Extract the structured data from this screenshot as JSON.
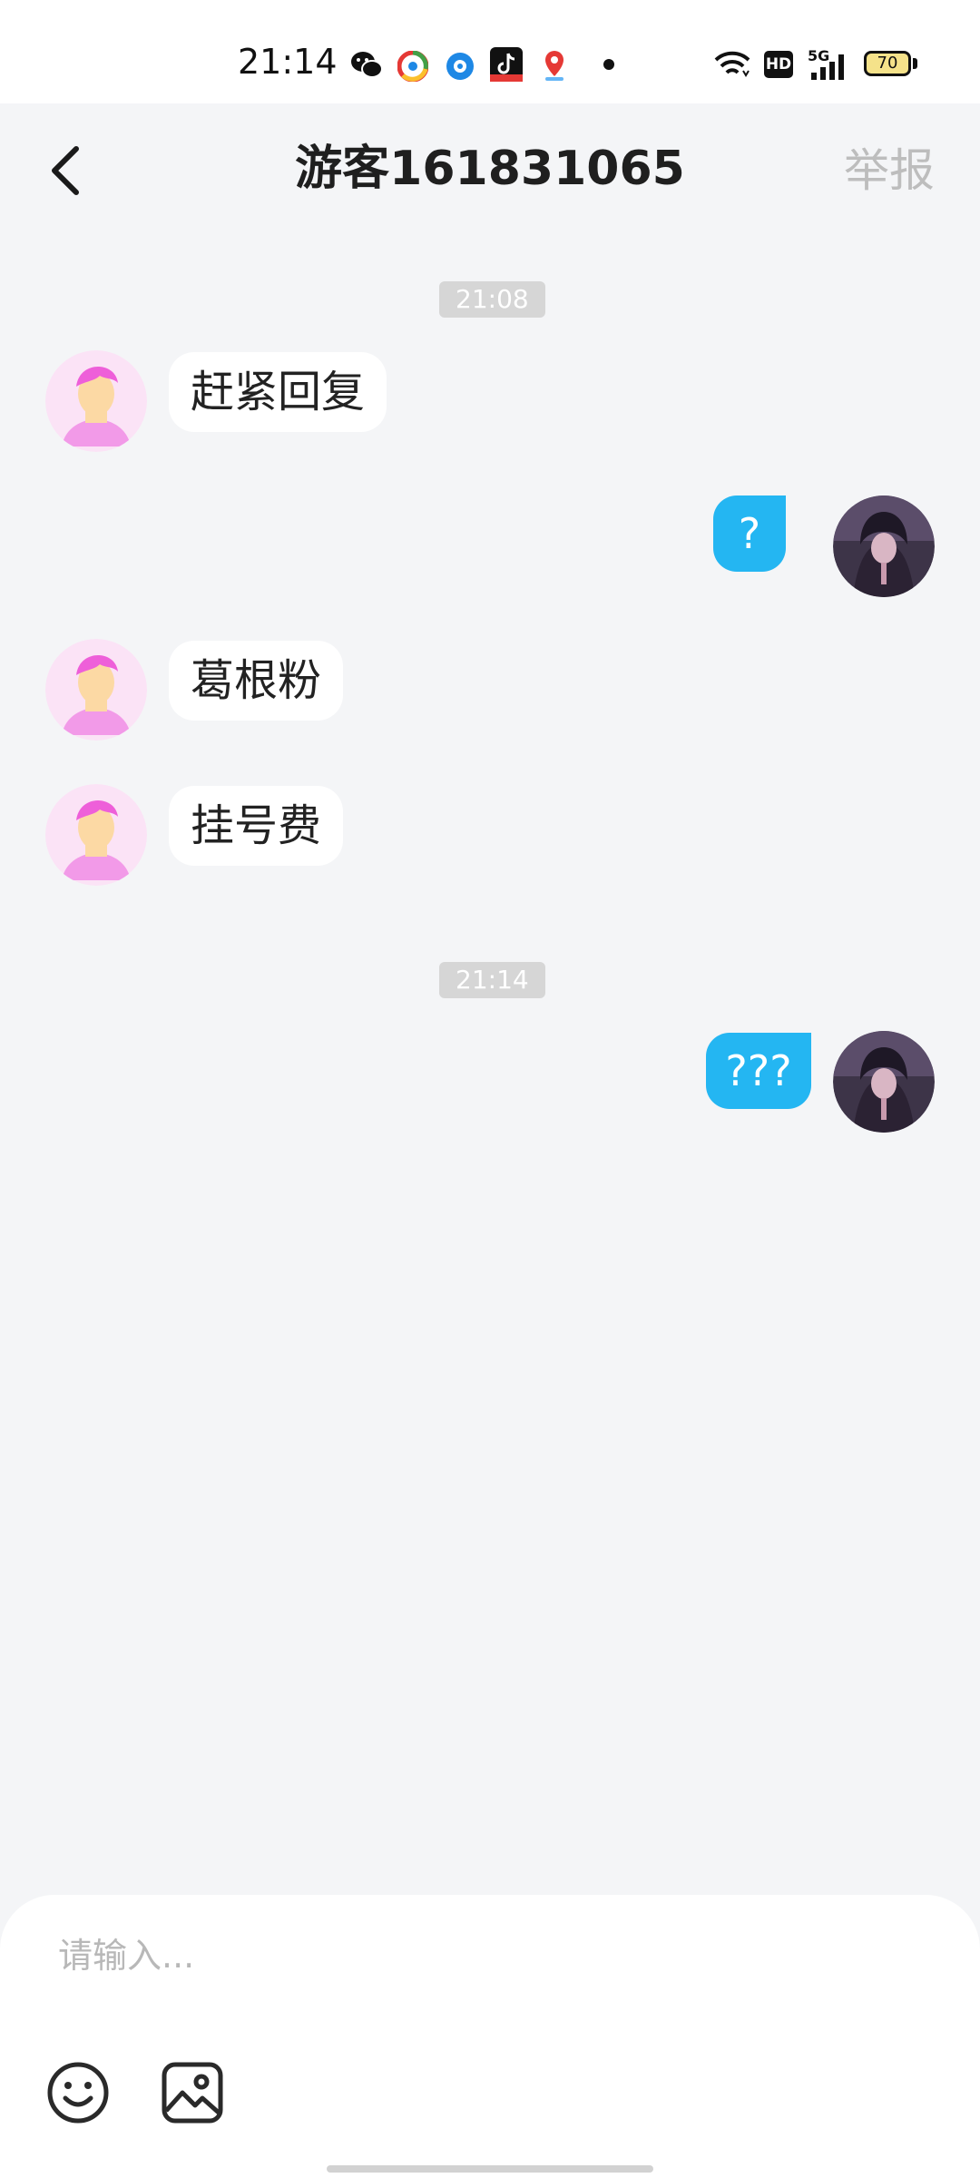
{
  "status_bar": {
    "time": "21:14",
    "battery": "70",
    "network": "HD",
    "signal_label": "5G",
    "icons": [
      "wechat-icon",
      "browser-icon",
      "baidu-icon",
      "tiktok-icon",
      "map-icon",
      "dot-icon",
      "wifi-icon",
      "hd-icon",
      "signal-icon",
      "battery-icon"
    ]
  },
  "header": {
    "title": "游客161831065",
    "report_label": "举报",
    "back_icon": "chevron-left-icon"
  },
  "messages": [
    {
      "type": "time",
      "text": "21:08"
    },
    {
      "type": "incoming",
      "text": "赶紧回复"
    },
    {
      "type": "outgoing",
      "text": "?"
    },
    {
      "type": "incoming",
      "text": "葛根粉"
    },
    {
      "type": "incoming",
      "text": "挂号费"
    },
    {
      "type": "time",
      "text": "21:14"
    },
    {
      "type": "outgoing",
      "text": "???"
    }
  ],
  "composer": {
    "placeholder": "请输入...",
    "emoji_icon": "emoji-icon",
    "image_icon": "image-icon"
  },
  "colors": {
    "background": "#f4f5f7",
    "outgoing_bubble": "#24b6f2",
    "incoming_bubble": "#ffffff",
    "time_pill": "#d6d6d6",
    "report_text": "#bdbdbd"
  }
}
